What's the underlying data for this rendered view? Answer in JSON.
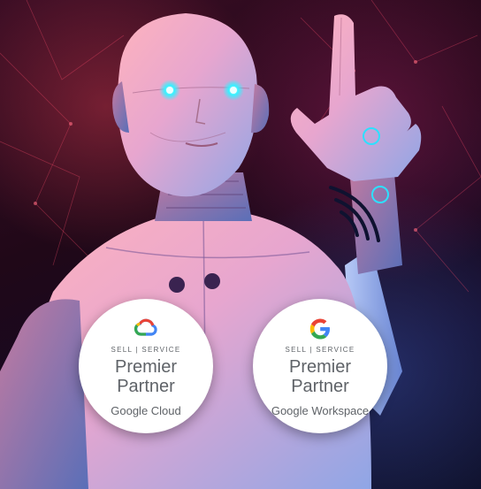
{
  "badges": [
    {
      "logo_icon": "google-cloud-logo-icon",
      "eyebrow": "SELL | SERVICE",
      "tier_line1": "Premier",
      "tier_line2": "Partner",
      "product": "Google Cloud"
    },
    {
      "logo_icon": "google-g-logo-icon",
      "eyebrow": "SELL | SERVICE",
      "tier_line1": "Premier",
      "tier_line2": "Partner",
      "product": "Google Workspace"
    }
  ],
  "colors": {
    "google_blue": "#4285F4",
    "google_red": "#EA4335",
    "google_yellow": "#FBBC05",
    "google_green": "#34A853",
    "badge_text": "#5f6368",
    "robot_eye_glow": "#38f0ff"
  }
}
